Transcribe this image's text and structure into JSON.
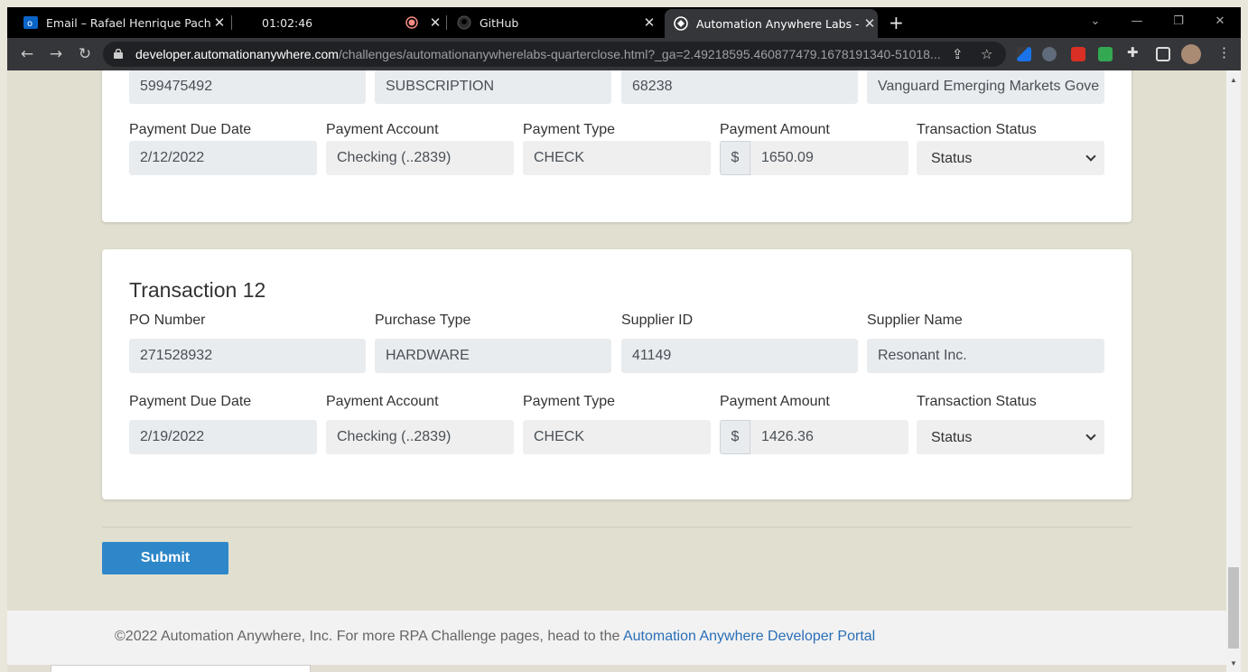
{
  "browser": {
    "tabs": [
      {
        "title": "Email – Rafael Henrique Pacheco",
        "icon": "outlook-icon"
      },
      {
        "title": "01:02:46",
        "icon": "timer-icon"
      },
      {
        "title": "",
        "icon": "record-icon"
      },
      {
        "title": "GitHub",
        "icon": "github-icon"
      },
      {
        "title": "Automation Anywhere Labs - Qu",
        "icon": "globe-icon"
      }
    ],
    "new_tab": "+",
    "url_host": "developer.automationanywhere.com",
    "url_path": "/challenges/automationanywherelabs-quarterclose.html?_ga=2.49218595.460877479.1678191340-51018..."
  },
  "prev_transaction": {
    "row1_values": [
      "599475492",
      "SUBSCRIPTION",
      "68238",
      "Vanguard Emerging Markets Gove"
    ],
    "labels": [
      "Payment Due Date",
      "Payment Account",
      "Payment Type",
      "Payment Amount",
      "Transaction Status"
    ],
    "payment_due_date": "2/12/2022",
    "payment_account": "Checking (..2839)",
    "payment_type": "CHECK",
    "currency": "$",
    "payment_amount": "1650.09",
    "status": "Status"
  },
  "transaction": {
    "title": "Transaction 12",
    "row1_labels": [
      "PO Number",
      "Purchase Type",
      "Supplier ID",
      "Supplier Name"
    ],
    "po_number": "271528932",
    "purchase_type": "HARDWARE",
    "supplier_id": "41149",
    "supplier_name": "Resonant Inc.",
    "row2_labels": [
      "Payment Due Date",
      "Payment Account",
      "Payment Type",
      "Payment Amount",
      "Transaction Status"
    ],
    "payment_due_date": "2/19/2022",
    "payment_account": "Checking (..2839)",
    "payment_type": "CHECK",
    "currency": "$",
    "payment_amount": "1426.36",
    "status": "Status"
  },
  "submit_label": "Submit",
  "footer": {
    "text": "©2022 Automation Anywhere, Inc. For more RPA Challenge pages, head to the ",
    "link": "Automation Anywhere Developer Portal"
  },
  "colors": {
    "accent": "#2e87c8",
    "page_bg": "#e1dfcf",
    "link": "#2a6fb8"
  }
}
